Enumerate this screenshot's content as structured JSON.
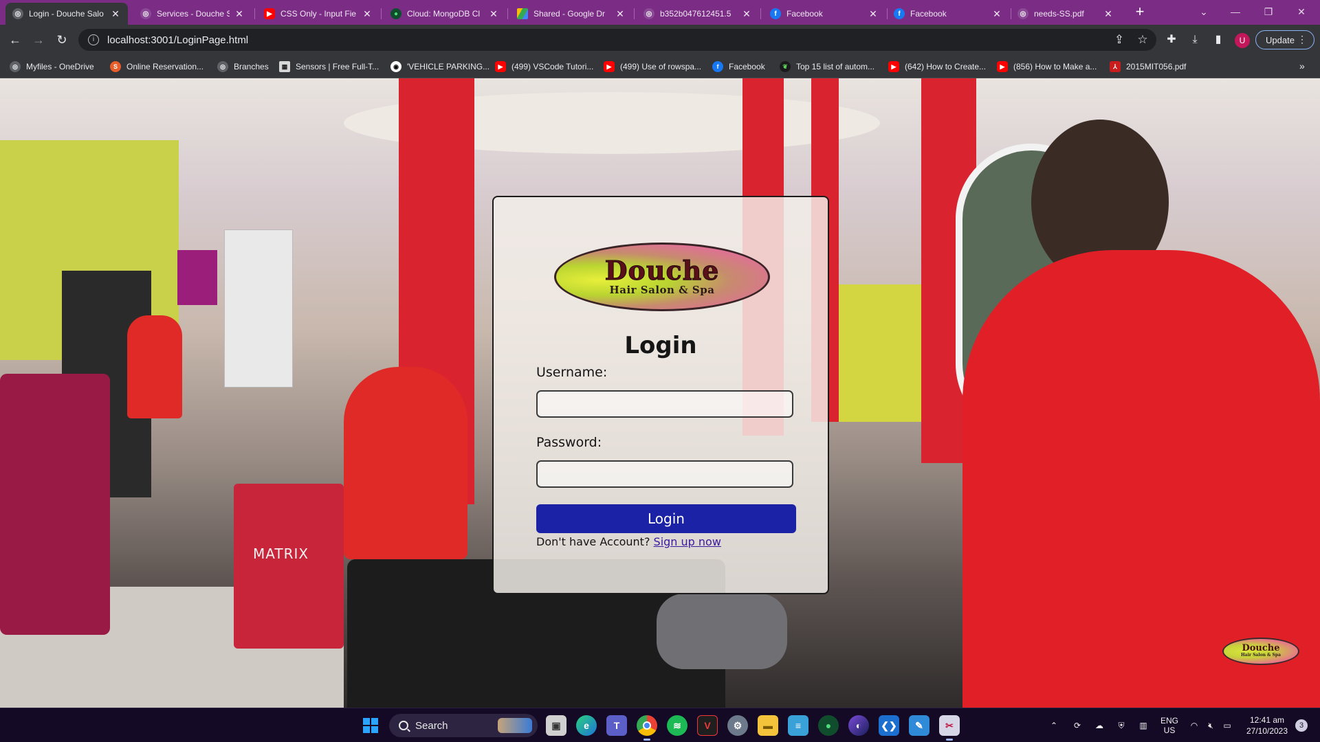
{
  "browser": {
    "tabs": [
      {
        "title": "Login - Douche Salo",
        "favicon": "globe-icon",
        "active": true
      },
      {
        "title": "Services - Douche S",
        "favicon": "globe-icon"
      },
      {
        "title": "CSS Only - Input Fie",
        "favicon": "youtube-icon"
      },
      {
        "title": "Cloud: MongoDB Cl",
        "favicon": "mongodb-icon"
      },
      {
        "title": "Shared - Google Dr",
        "favicon": "google-drive-icon"
      },
      {
        "title": "b352b047612451.5",
        "favicon": "globe-icon"
      },
      {
        "title": "Facebook",
        "favicon": "facebook-icon"
      },
      {
        "title": "Facebook",
        "favicon": "facebook-icon"
      },
      {
        "title": "needs-SS.pdf",
        "favicon": "globe-icon"
      }
    ],
    "url": "localhost:3001/LoginPage.html",
    "update_label": "Update",
    "profile_initial": "U",
    "bookmarks": [
      {
        "label": "Myfiles - OneDrive",
        "icon": "globe-icon"
      },
      {
        "label": "Online Reservation...",
        "icon": "s-logo-icon"
      },
      {
        "label": "Branches",
        "icon": "globe-icon"
      },
      {
        "label": "Sensors | Free Full-T...",
        "icon": "sensors-icon"
      },
      {
        "label": "'VEHICLE PARKING...",
        "icon": "github-icon"
      },
      {
        "label": "(499) VSCode Tutori...",
        "icon": "youtube-icon"
      },
      {
        "label": "(499) Use of rowspa...",
        "icon": "youtube-icon"
      },
      {
        "label": "Facebook",
        "icon": "facebook-icon"
      },
      {
        "label": "Top 15 list of autom...",
        "icon": "leaf-icon"
      },
      {
        "label": "(642) How to Create...",
        "icon": "youtube-icon"
      },
      {
        "label": "(856) How to Make a...",
        "icon": "youtube-icon"
      },
      {
        "label": "2015MIT056.pdf",
        "icon": "pdf-icon"
      }
    ]
  },
  "page": {
    "logo_brand": "Douche",
    "logo_sub": "Hair Salon & Spa",
    "login_title": "Login",
    "username_label": "Username:",
    "username_value": "",
    "password_label": "Password:",
    "password_value": "",
    "login_button": "Login",
    "signup_prompt": "Don't have Account?",
    "signup_link": "Sign up now",
    "background_sign": "MATRIX"
  },
  "taskbar": {
    "search_label": "Search",
    "apps": [
      "file-explorer-window-icon",
      "edge-icon",
      "teams-icon",
      "chrome-icon",
      "spotify-icon",
      "vivaldi-icon",
      "settings-icon",
      "folder-icon",
      "notepad-icon",
      "mongodb-compass-icon",
      "firefox-icon",
      "vscode-icon",
      "paint-icon",
      "snipping-tool-icon"
    ],
    "language_line1": "ENG",
    "language_line2": "US",
    "time": "12:41 am",
    "date": "27/10/2023",
    "notification_count": "3"
  },
  "colors": {
    "tab_strip": "#7b2d86",
    "login_button": "#1b22a5",
    "signup_link": "#3a1a9e"
  }
}
